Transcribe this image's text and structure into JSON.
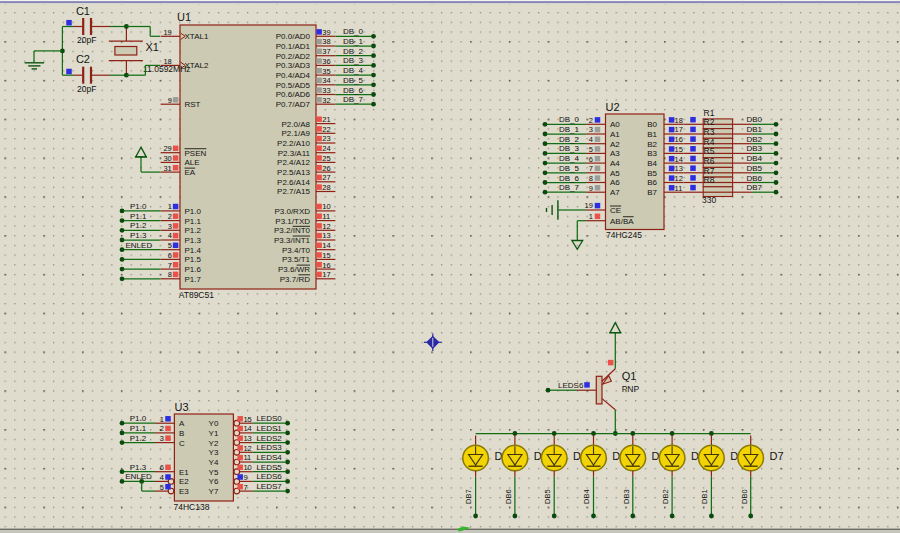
{
  "app": {
    "description": "Proteus ISIS schematic - AT89C51 LED driver circuit"
  },
  "colors": {
    "canvas": "#dfdccd",
    "grid_dot": "#8d8d7f",
    "grid_dot_major": "#55554a",
    "component": "#8e2015",
    "component_fill": "#cccab2",
    "transistor_fill": "#d2c3ac",
    "wire": "#116e15",
    "junction": "#0a4a0c",
    "terminal": "#0d5511",
    "state_high": "#ea5149",
    "state_low": "#2e2ee0",
    "state_float": "#9d9d97",
    "text": "#141414",
    "led_fill": "#f2d303",
    "led_ring": "#8a7a00",
    "led_symbol": "#413508",
    "origin_marker": "#2929a3",
    "cursor": "#35b52d",
    "window_top_line": "#8383b8",
    "window_bottom_line": "#6d6d67",
    "window_bottom_strip": "#c6c6bc"
  },
  "components": {
    "u1": {
      "ref": "U1",
      "value": "AT89C51",
      "left_pins": [
        {
          "num": "19",
          "name": "XTAL1",
          "row": 0,
          "clock": true
        },
        {
          "num": "18",
          "name": "XTAL2",
          "row": 3,
          "clock": true
        },
        {
          "num": "9",
          "name": "RST",
          "row": 7,
          "state": "float"
        },
        {
          "num": "29",
          "name": "~PSEN~",
          "row": 12,
          "state": "high"
        },
        {
          "num": "30",
          "name": "ALE",
          "row": 13,
          "state": "high"
        },
        {
          "num": "31",
          "name": "~EA~",
          "row": 14,
          "state": "high",
          "power": true
        },
        {
          "num": "1",
          "name": "P1.0",
          "row": 18,
          "state": "low",
          "net": "P1.0"
        },
        {
          "num": "2",
          "name": "P1.1",
          "row": 19,
          "state": "high",
          "net": "P1.1"
        },
        {
          "num": "3",
          "name": "P1.2",
          "row": 20,
          "state": "high",
          "net": "P1.2"
        },
        {
          "num": "4",
          "name": "P1.3",
          "row": 21,
          "state": "high",
          "net": "P1.3"
        },
        {
          "num": "5",
          "name": "P1.4",
          "row": 22,
          "state": "low",
          "net": "ENLED",
          "label_dx": -4.5
        },
        {
          "num": "6",
          "name": "P1.5",
          "row": 23,
          "state": "high",
          "wire": true
        },
        {
          "num": "7",
          "name": "P1.6",
          "row": 24,
          "state": "high",
          "wire": true
        },
        {
          "num": "8",
          "name": "P1.7",
          "row": 25,
          "state": "high",
          "wire": true
        }
      ],
      "right_pins": [
        {
          "num": "39",
          "name": "P0.0/AD0",
          "row": 0,
          "state": "low",
          "net": "DB_0"
        },
        {
          "num": "38",
          "name": "P0.1/AD1",
          "row": 1,
          "state": "float",
          "net": "DB_1"
        },
        {
          "num": "37",
          "name": "P0.2/AD2",
          "row": 2,
          "state": "float",
          "net": "DB_2"
        },
        {
          "num": "36",
          "name": "P0.3/AD3",
          "row": 3,
          "state": "float",
          "net": "DB_3"
        },
        {
          "num": "35",
          "name": "P0.4/AD4",
          "row": 4,
          "state": "float",
          "net": "DB_4"
        },
        {
          "num": "34",
          "name": "P0.5/AD5",
          "row": 5,
          "state": "float",
          "net": "DB_5"
        },
        {
          "num": "33",
          "name": "P0.6/AD6",
          "row": 6,
          "state": "float",
          "net": "DB_6"
        },
        {
          "num": "32",
          "name": "P0.7/AD7",
          "row": 7,
          "state": "float",
          "net": "DB_7"
        },
        {
          "num": "21",
          "name": "P2.0/A8",
          "row": 9,
          "state": "high"
        },
        {
          "num": "22",
          "name": "P2.1/A9",
          "row": 10,
          "state": "high"
        },
        {
          "num": "23",
          "name": "P2.2/A10",
          "row": 11,
          "state": "high"
        },
        {
          "num": "24",
          "name": "P2.3/A11",
          "row": 12,
          "state": "high"
        },
        {
          "num": "25",
          "name": "P2.4/A12",
          "row": 13,
          "state": "high"
        },
        {
          "num": "26",
          "name": "P2.5/A13",
          "row": 14,
          "state": "high"
        },
        {
          "num": "27",
          "name": "P2.6/A14",
          "row": 15,
          "state": "high"
        },
        {
          "num": "28",
          "name": "P2.7/A15",
          "row": 16,
          "state": "high"
        },
        {
          "num": "10",
          "name": "P3.0/RXD",
          "row": 18,
          "state": "high"
        },
        {
          "num": "11",
          "name": "P3.1/TXD",
          "row": 19,
          "state": "high"
        },
        {
          "num": "12",
          "name": "P3.2/~INT0~",
          "row": 20,
          "state": "high"
        },
        {
          "num": "13",
          "name": "P3.3/~INT1~",
          "row": 21,
          "state": "high"
        },
        {
          "num": "14",
          "name": "P3.4/T0",
          "row": 22,
          "state": "high"
        },
        {
          "num": "15",
          "name": "P3.5/T1",
          "row": 23,
          "state": "high"
        },
        {
          "num": "16",
          "name": "P3.6/~WR~",
          "row": 24,
          "state": "high"
        },
        {
          "num": "17",
          "name": "P3.7/~RD~",
          "row": 25,
          "state": "high"
        }
      ]
    },
    "u2": {
      "ref": "U2",
      "value": "74HC245",
      "left_pins": [
        {
          "num": "2",
          "name": "A0",
          "row": 0,
          "state": "low",
          "net": "DB_0"
        },
        {
          "num": "3",
          "name": "A1",
          "row": 1,
          "state": "float",
          "net": "DB_1"
        },
        {
          "num": "4",
          "name": "A2",
          "row": 2,
          "state": "float",
          "net": "DB_2"
        },
        {
          "num": "5",
          "name": "A3",
          "row": 3,
          "state": "float",
          "net": "DB_3"
        },
        {
          "num": "6",
          "name": "A4",
          "row": 4,
          "state": "float",
          "net": "DB_4"
        },
        {
          "num": "7",
          "name": "A5",
          "row": 5,
          "state": "float",
          "net": "DB_5"
        },
        {
          "num": "8",
          "name": "A6",
          "row": 6,
          "state": "float",
          "net": "DB_6"
        },
        {
          "num": "9",
          "name": "A7",
          "row": 7,
          "state": "float",
          "net": "DB_7"
        },
        {
          "num": "19",
          "name": "~CE~",
          "state": "low",
          "special": "gnd_left"
        },
        {
          "num": "1",
          "name": "AB/~BA~",
          "state": "high",
          "special": "gnd_down"
        }
      ],
      "right_pins": [
        {
          "num": "18",
          "name": "B0",
          "row": 0,
          "state": "low"
        },
        {
          "num": "17",
          "name": "B1",
          "row": 1,
          "state": "low"
        },
        {
          "num": "16",
          "name": "B2",
          "row": 2,
          "state": "low"
        },
        {
          "num": "15",
          "name": "B3",
          "row": 3,
          "state": "low"
        },
        {
          "num": "14",
          "name": "B4",
          "row": 4,
          "state": "low"
        },
        {
          "num": "13",
          "name": "B5",
          "row": 5,
          "state": "low"
        },
        {
          "num": "12",
          "name": "B6",
          "row": 6,
          "state": "low"
        },
        {
          "num": "11",
          "name": "B7",
          "row": 7,
          "state": "low"
        }
      ]
    },
    "r_network": {
      "refs": [
        "R1",
        "R2",
        "R3",
        "R4",
        "R5",
        "R6",
        "R7",
        "R8"
      ],
      "value": "330",
      "input_state": "low",
      "outputs": [
        "DB0",
        "DB1",
        "DB2",
        "DB3",
        "DB4",
        "DB5",
        "DB6",
        "DB7"
      ]
    },
    "u3": {
      "ref": "U3",
      "value": "74HC138",
      "left_pins": [
        {
          "num": "1",
          "name": "A",
          "row": 0,
          "state": "low",
          "net": "P1.0"
        },
        {
          "num": "2",
          "name": "B",
          "row": 1,
          "state": "high",
          "net": "P1.1"
        },
        {
          "num": "3",
          "name": "C",
          "row": 2,
          "state": "high",
          "net": "P1.2"
        },
        {
          "num": "6",
          "name": "E1",
          "row": 5,
          "state": "high",
          "net": "P1.3"
        },
        {
          "num": "4",
          "name": "E2",
          "row": 6,
          "state": "low",
          "net": "ENLED",
          "bubble": true,
          "label_dx": -4.5,
          "branch": true
        },
        {
          "num": "5",
          "name": "E3",
          "row": 7,
          "state": "low",
          "bubble": true,
          "branch_target": true
        }
      ],
      "right_pins": [
        {
          "num": "15",
          "name": "Y0",
          "row": 0,
          "state": "high",
          "net": "LEDS0",
          "bubble": true
        },
        {
          "num": "14",
          "name": "Y1",
          "row": 1,
          "state": "high",
          "net": "LEDS1",
          "bubble": true
        },
        {
          "num": "13",
          "name": "Y2",
          "row": 2,
          "state": "high",
          "net": "LEDS2",
          "bubble": true
        },
        {
          "num": "12",
          "name": "Y3",
          "row": 3,
          "state": "high",
          "net": "LEDS3",
          "bubble": true
        },
        {
          "num": "11",
          "name": "Y4",
          "row": 4,
          "state": "high",
          "net": "LEDS4",
          "bubble": true
        },
        {
          "num": "10",
          "name": "Y5",
          "row": 5,
          "state": "high",
          "net": "LEDS5",
          "bubble": true
        },
        {
          "num": "9",
          "name": "Y6",
          "row": 6,
          "state": "low",
          "net": "LEDS6",
          "bubble": true
        },
        {
          "num": "7",
          "name": "Y7",
          "row": 7,
          "state": "high",
          "net": "LEDS7",
          "bubble": true
        }
      ]
    },
    "c1": {
      "ref": "C1",
      "value": "20pF",
      "state": "low"
    },
    "c2": {
      "ref": "C2",
      "value": "20pF",
      "state": "low"
    },
    "x1": {
      "ref": "X1",
      "value": "11.0592MHz"
    },
    "q1": {
      "ref": "Q1",
      "value": "PNP",
      "base_net": "LEDS6",
      "base_state": "low",
      "emitter_state": "high"
    },
    "leds": {
      "refs": [
        "D0",
        "D3",
        "D2",
        "D1",
        "D4",
        "D5",
        "D6",
        "D7"
      ],
      "cathode_nets": [
        "DB7",
        "DB6",
        "DB5",
        "DB4",
        "DB3",
        "DB2",
        "DB1",
        "DB0"
      ]
    }
  }
}
